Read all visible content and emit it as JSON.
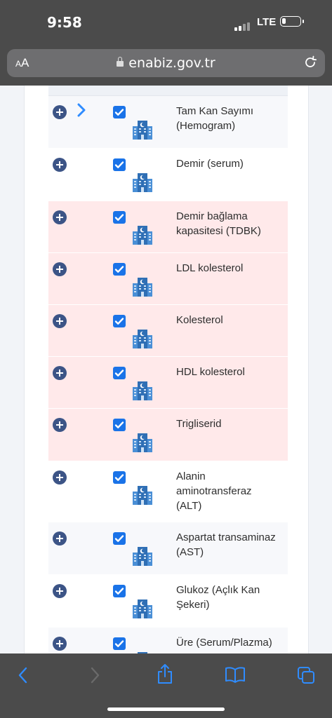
{
  "status_bar": {
    "time": "9:58",
    "network": "LTE"
  },
  "browser": {
    "text_size_label": "AA",
    "url": "enabiz.gov.tr"
  },
  "colors": {
    "accent": "#1a73e8",
    "plus": "#3c5486",
    "highlight": "#ffe9ea"
  },
  "tests": [
    {
      "name": "Tam Kan Sayımı (Hemogram)",
      "checked": true,
      "abnormal": false,
      "expanded_arrow": true
    },
    {
      "name": "Demir (serum)",
      "checked": true,
      "abnormal": false
    },
    {
      "name": "Demir bağlama kapasitesi (TDBK)",
      "checked": true,
      "abnormal": true
    },
    {
      "name": "LDL kolesterol",
      "checked": true,
      "abnormal": true
    },
    {
      "name": "Kolesterol",
      "checked": true,
      "abnormal": true
    },
    {
      "name": "HDL kolesterol",
      "checked": true,
      "abnormal": true
    },
    {
      "name": "Trigliserid",
      "checked": true,
      "abnormal": true
    },
    {
      "name": "Alanin aminotransferaz (ALT)",
      "checked": true,
      "abnormal": false
    },
    {
      "name": "Aspartat transaminaz (AST)",
      "checked": true,
      "abnormal": false
    },
    {
      "name": "Glukoz (Açlık Kan Şekeri)",
      "checked": true,
      "abnormal": false
    },
    {
      "name": "Üre (Serum/Plazma)",
      "checked": true,
      "abnormal": false
    }
  ],
  "toolbar": {
    "icons": [
      "back-icon",
      "forward-icon",
      "share-icon",
      "bookmarks-icon",
      "tabs-icon"
    ]
  }
}
